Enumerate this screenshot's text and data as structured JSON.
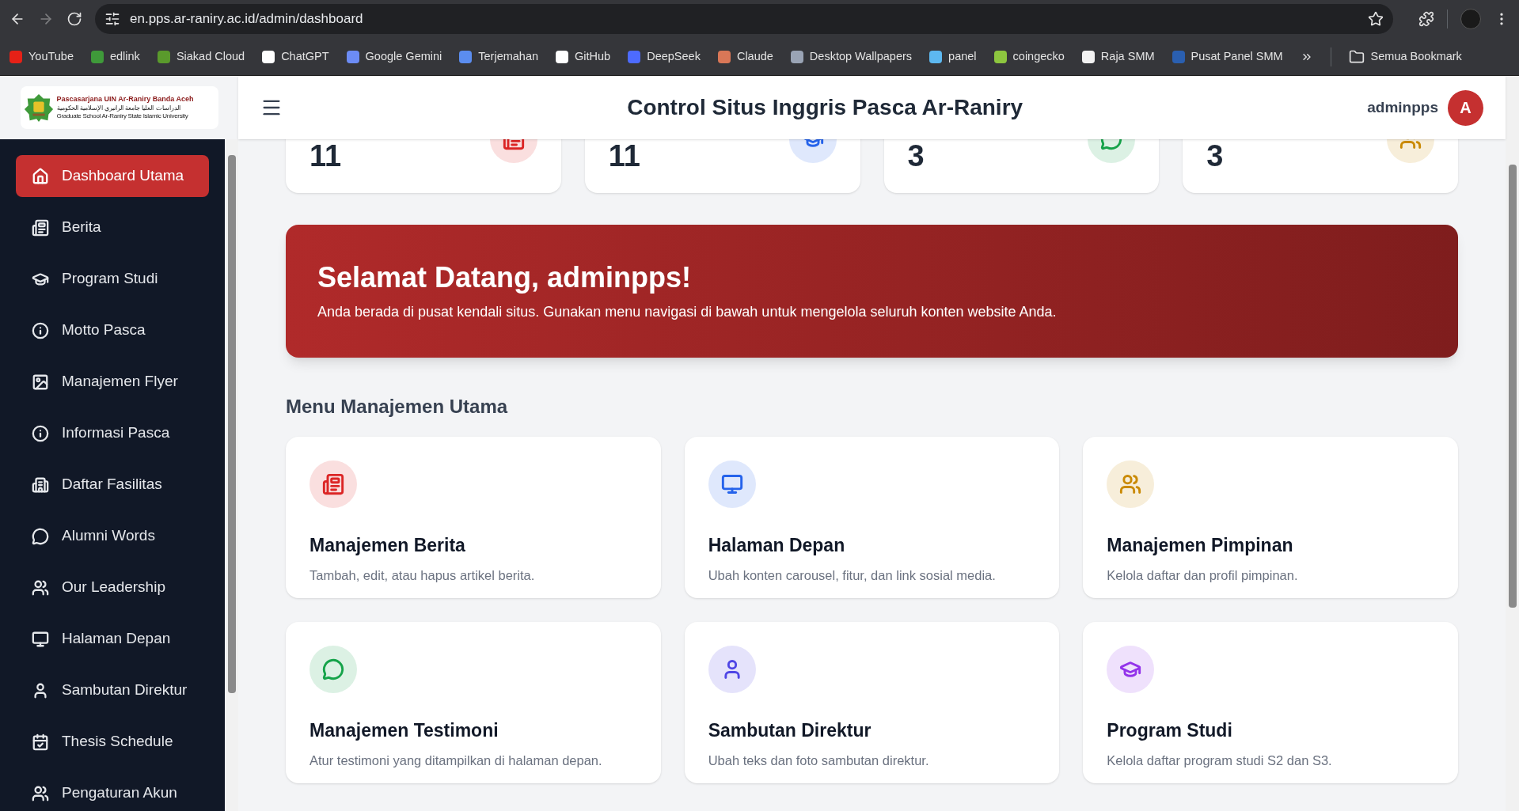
{
  "browser": {
    "url": "en.pps.ar-raniry.ac.id/admin/dashboard",
    "bookmarks": [
      "YouTube",
      "edlink",
      "Siakad Cloud",
      "ChatGPT",
      "Google Gemini",
      "Terjemahan",
      "GitHub",
      "DeepSeek",
      "Claude",
      "Desktop Wallpapers",
      "panel",
      "coingecko",
      "Raja SMM",
      "Pusat Panel SMM"
    ],
    "all_bookmarks": "Semua Bookmark"
  },
  "logo": {
    "title": "Pascasarjana UIN Ar-Raniry Banda Aceh",
    "arabic": "الدراسات العليا جامعة الرانيري الإسلامية الحكومية",
    "subtitle": "Graduate School Ar-Raniry State Islamic University"
  },
  "sidebar": {
    "items": [
      {
        "label": "Dashboard Utama",
        "selected": true
      },
      {
        "label": "Berita",
        "selected": false
      },
      {
        "label": "Program Studi",
        "selected": false
      },
      {
        "label": "Motto Pasca",
        "selected": false
      },
      {
        "label": "Manajemen Flyer",
        "selected": false
      },
      {
        "label": "Informasi Pasca",
        "selected": false
      },
      {
        "label": "Daftar Fasilitas",
        "selected": false
      },
      {
        "label": "Alumni Words",
        "selected": false
      },
      {
        "label": "Our Leadership",
        "selected": false
      },
      {
        "label": "Halaman Depan",
        "selected": false
      },
      {
        "label": "Sambutan Direktur",
        "selected": false
      },
      {
        "label": "Thesis Schedule",
        "selected": false
      },
      {
        "label": "Pengaturan Akun",
        "selected": false
      }
    ]
  },
  "header": {
    "title": "Control Situs Inggris Pasca Ar-Raniry",
    "user": "adminpps",
    "avatar": "A"
  },
  "stats": [
    "11",
    "11",
    "3",
    "3"
  ],
  "welcome": {
    "title": "Selamat Datang, adminpps!",
    "text": "Anda berada di pusat kendali situs. Gunakan menu navigasi di bawah untuk mengelola seluruh konten website Anda."
  },
  "menu": {
    "heading": "Menu Manajemen Utama",
    "cards": [
      {
        "title": "Manajemen Berita",
        "text": "Tambah, edit, atau hapus artikel berita."
      },
      {
        "title": "Halaman Depan",
        "text": "Ubah konten carousel, fitur, dan link sosial media."
      },
      {
        "title": "Manajemen Pimpinan",
        "text": "Kelola daftar dan profil pimpinan."
      },
      {
        "title": "Manajemen Testimoni",
        "text": "Atur testimoni yang ditampilkan di halaman depan."
      },
      {
        "title": "Sambutan Direktur",
        "text": "Ubah teks dan foto sambutan direktur."
      },
      {
        "title": "Program Studi",
        "text": "Kelola daftar program studi S2 dan S3."
      }
    ]
  }
}
